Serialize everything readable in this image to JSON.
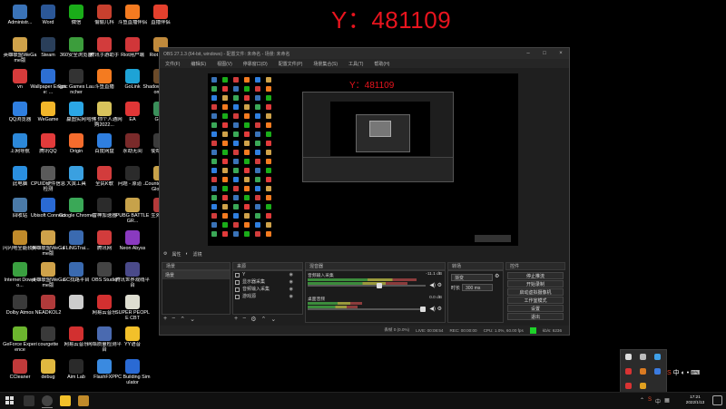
{
  "overlay": {
    "text": "Y：481109"
  },
  "desktop_icons": [
    {
      "label": "Administr...",
      "color": "#3a73b8"
    },
    {
      "label": "Word",
      "color": "#2b5797"
    },
    {
      "label": "微信",
      "color": "#1aad19"
    },
    {
      "label": "偷偷儿科",
      "color": "#c7402e"
    },
    {
      "label": "斗鱼直播伴侣",
      "color": "#f47b20"
    },
    {
      "label": "直播伴侣",
      "color": "#e4402d"
    },
    {
      "label": "英雄联盟WeGame版",
      "color": "#cfa24a"
    },
    {
      "label": "Steam",
      "color": "#2a3f5a"
    },
    {
      "label": "360安全浏览器",
      "color": "#3c9d3c"
    },
    {
      "label": "腾讯手游助手",
      "color": "#d23c3c"
    },
    {
      "label": "Riot用户端",
      "color": "#d13639"
    },
    {
      "label": "Riot Client",
      "color": "#c08a3c"
    },
    {
      "label": "vn",
      "color": "#d63b3b"
    },
    {
      "label": "Wallpaper Engine: ...",
      "color": "#2d6fd4"
    },
    {
      "label": "Epic Games Launcher",
      "color": "#333333"
    },
    {
      "label": "斗鱼直播",
      "color": "#f47b20"
    },
    {
      "label": "GoLink",
      "color": "#1ea3d6"
    },
    {
      "label": "Shadow of the Tomb...",
      "color": "#6b4b2a"
    },
    {
      "label": "QQ浏览器",
      "color": "#2f7fe0"
    },
    {
      "label": "WeGame",
      "color": "#f2b62a"
    },
    {
      "label": "赢图实网",
      "color": "#2ba7e6"
    },
    {
      "label": "哈佛 你个人通网购2022...",
      "color": "#d8c35c"
    },
    {
      "label": "EA",
      "color": "#e03636"
    },
    {
      "label": "Geek",
      "color": "#3a8f5a"
    },
    {
      "label": "上网导航",
      "color": "#2c88d9"
    },
    {
      "label": "腾讯QQ",
      "color": "#e23b3b"
    },
    {
      "label": "Origin",
      "color": "#f56c2d"
    },
    {
      "label": "百度网盘",
      "color": "#2f7fe0"
    },
    {
      "label": "永劫无间",
      "color": "#7a2a2a"
    },
    {
      "label": "使命召唤",
      "color": "#3a3a3a"
    },
    {
      "label": "此电脑",
      "color": "#2a8fe0"
    },
    {
      "label": "CPUID硬件信息检测",
      "color": "#5a5a5a"
    },
    {
      "label": "大黄工具",
      "color": "#3aa0e0"
    },
    {
      "label": "全民K歌",
      "color": "#d23c3c"
    },
    {
      "label": "问题 - 原道 ...",
      "color": "#2b2b2b"
    },
    {
      "label": "Counter-Strike Global...",
      "color": "#c7a24a"
    },
    {
      "label": "回收站",
      "color": "#4a7aa8"
    },
    {
      "label": "Ubisoft Connect",
      "color": "#2a6ad4"
    },
    {
      "label": "Google Chrome",
      "color": "#3aa857"
    },
    {
      "label": "雷神加速器",
      "color": "#2b2b2b"
    },
    {
      "label": "PUBG BATTLEGR...",
      "color": "#c7a24a"
    },
    {
      "label": "生死狙击",
      "color": "#b33a3a"
    },
    {
      "label": "闪闪电全能软件",
      "color": "#c08a2a"
    },
    {
      "label": "英雄联盟WeGame版",
      "color": "#cfa24a"
    },
    {
      "label": "FLiNGTrai...",
      "color": "#3a6ab0"
    },
    {
      "label": "腾讯网",
      "color": "#d23c3c"
    },
    {
      "label": "Neon Abyss",
      "color": "#8a3ac0"
    },
    {
      "label": "",
      "color": "#000000"
    },
    {
      "label": "Internet Downlo...",
      "color": "#3aa040"
    },
    {
      "label": "英雄联盟WeGame版",
      "color": "#cfa24a"
    },
    {
      "label": "SC找路平台",
      "color": "#3a6ab0"
    },
    {
      "label": "OBS Studio",
      "color": "#444444"
    },
    {
      "label": "腾讯世界观线平台",
      "color": "#4a4a8a"
    },
    {
      "label": "",
      "color": "#000000"
    },
    {
      "label": "Dolby Atmos",
      "color": "#3a3a3a"
    },
    {
      "label": "NEADKOL2",
      "color": "#b03a3a"
    },
    {
      "label": "",
      "color": "#cccccc"
    },
    {
      "label": "网易云音乐",
      "color": "#d23030"
    },
    {
      "label": "SUPER PEOPLE CBT",
      "color": "#ddddd0"
    },
    {
      "label": "",
      "color": "#000000"
    },
    {
      "label": "GeForce Experience",
      "color": "#6cb52e"
    },
    {
      "label": "courgette",
      "color": "#3a3a3a"
    },
    {
      "label": "网易云音乐",
      "color": "#d23030"
    },
    {
      "label": "网络质量检测平台",
      "color": "#4a6ab0"
    },
    {
      "label": "YY语音",
      "color": "#f2c02a"
    },
    {
      "label": "",
      "color": "#000000"
    },
    {
      "label": "CCleaner",
      "color": "#c03a3a"
    },
    {
      "label": "debug",
      "color": "#e0b840"
    },
    {
      "label": "Aim Lab",
      "color": "#2a2a2a"
    },
    {
      "label": "FlashFXP",
      "color": "#3a8ae0"
    },
    {
      "label": "PC Building Simulator",
      "color": "#2a6ad4"
    },
    {
      "label": "",
      "color": "#000000"
    }
  ],
  "obs": {
    "title": "OBS 27.1.3 (64-bit, windows) - 配置文件: 未命名 - 场景: 未命名",
    "menu": [
      "文件(F)",
      "编辑(E)",
      "视图(V)",
      "停靠窗口(D)",
      "配置文件(P)",
      "场景集合(S)",
      "工具(T)",
      "帮助(H)"
    ],
    "preview_text": "Y：481109",
    "source_toolbar": [
      "属性",
      "滤镜"
    ],
    "panels": {
      "scenes": "场景",
      "sources": "来源",
      "mixer": "混音器",
      "transitions": "转场",
      "controls": "控件"
    },
    "scene_items": [
      "场景"
    ],
    "source_items": [
      "Y",
      "显示器采集",
      "音频输入采集",
      "游戏源"
    ],
    "mixer": [
      {
        "name": "音频输入采集",
        "db": "-11.1 dB"
      },
      {
        "name": "桌面音频",
        "db": "0.0 dB"
      }
    ],
    "transition": {
      "type": "渐变",
      "duration_label": "时长",
      "duration": "300 ms"
    },
    "controls": [
      "停止推流",
      "开始录制",
      "启动虚拟摄像机",
      "工作室模式",
      "设置",
      "退出"
    ],
    "status": {
      "dropped": "丢帧 0 (0.0%)",
      "live": "LIVE: 00:08:54",
      "rec": "REC: 00:00:00",
      "cpu": "CPU: 1.0%, 60.00 fps",
      "kbps": "kb/s: 6236"
    }
  },
  "taskbar": {
    "time": "17:21",
    "date": "2022/1/13"
  }
}
